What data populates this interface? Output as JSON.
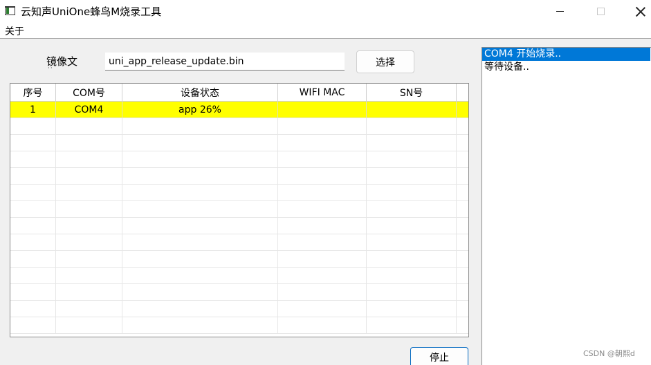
{
  "window": {
    "title": "云知声UniOne蜂鸟M烧录工具",
    "icon": "app-window-icon",
    "minimize_icon": "minimize-icon",
    "maximize_icon": "maximize-icon",
    "close_icon": "close-icon"
  },
  "menu": {
    "items": [
      {
        "label": "关于"
      }
    ]
  },
  "file": {
    "label": "镜像文",
    "label_overflow": "··",
    "value": "uni_app_release_update.bin",
    "select_button": "选择"
  },
  "table": {
    "columns": [
      "序号",
      "COM号",
      "设备状态",
      "WIFI MAC",
      "SN号"
    ],
    "rows": [
      {
        "index": "1",
        "com": "COM4",
        "status": "app 26%",
        "wifi_mac": "",
        "sn": "",
        "highlight": "#ffff00"
      }
    ],
    "empty_rows": 13
  },
  "log": {
    "lines": [
      "COM4 开始烧录..",
      "等待设备.."
    ],
    "selected_index": 0
  },
  "actions": {
    "stop_button": "停止"
  },
  "watermark": "CSDN @朝熙d",
  "colors": {
    "selection": "#0078d7",
    "row_highlight": "#ffff00"
  }
}
